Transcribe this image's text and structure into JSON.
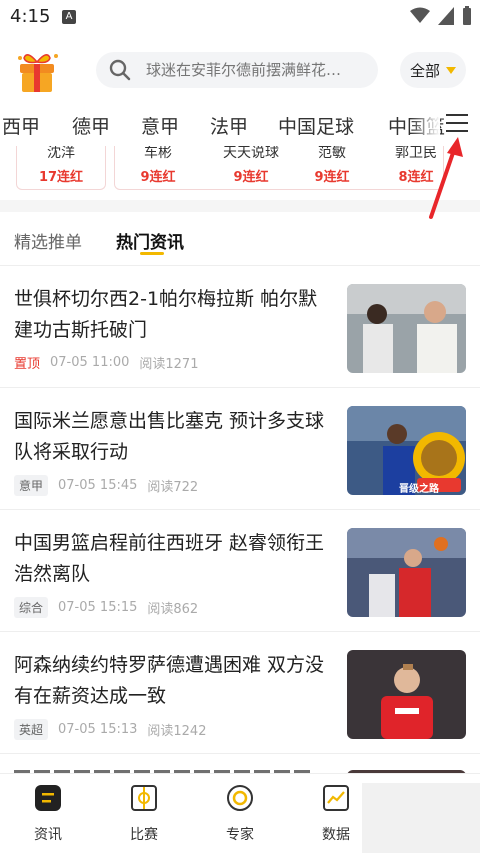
{
  "status": {
    "time": "4:15",
    "a_badge": "A"
  },
  "search": {
    "placeholder": "球迷在安菲尔德前摆满鲜花…"
  },
  "header": {
    "filter_label": "全部"
  },
  "leagues": [
    "西甲",
    "德甲",
    "意甲",
    "法甲",
    "中国足球",
    "中国篮"
  ],
  "streaks": [
    {
      "name": "沈洋",
      "count": "17连红"
    },
    {
      "name": "车彬",
      "count": "9连红"
    },
    {
      "name": "天天说球",
      "count": "9连红"
    },
    {
      "name": "范敏",
      "count": "9连红"
    },
    {
      "name": "郭卫民",
      "count": "8连红"
    }
  ],
  "sub_tabs": {
    "tab1": "精选推单",
    "tab2": "热门资讯"
  },
  "news": [
    {
      "title": "世俱杯切尔西2-1帕尔梅拉斯 帕尔默建功古斯托破门",
      "tag": "置顶",
      "date": "07-05 11:00",
      "reads": "阅读1271"
    },
    {
      "title": "国际米兰愿意出售比塞克 预计多支球队将采取行动",
      "tag": "意甲",
      "date": "07-05 15:45",
      "reads": "阅读722",
      "badge": "晋级之路"
    },
    {
      "title": "中国男篮启程前往西班牙 赵睿领衔王浩然离队",
      "tag": "综合",
      "date": "07-05 15:15",
      "reads": "阅读862"
    },
    {
      "title": "阿森纳续约特罗萨德遭遇困难 双方没有在薪资达成一致",
      "tag": "英超",
      "date": "07-05 15:13",
      "reads": "阅读1242"
    }
  ],
  "nav": [
    {
      "label": "资讯"
    },
    {
      "label": "比赛"
    },
    {
      "label": "专家"
    },
    {
      "label": "数据"
    }
  ],
  "colors": {
    "accent": "#f2b800",
    "red": "#e8392f"
  }
}
